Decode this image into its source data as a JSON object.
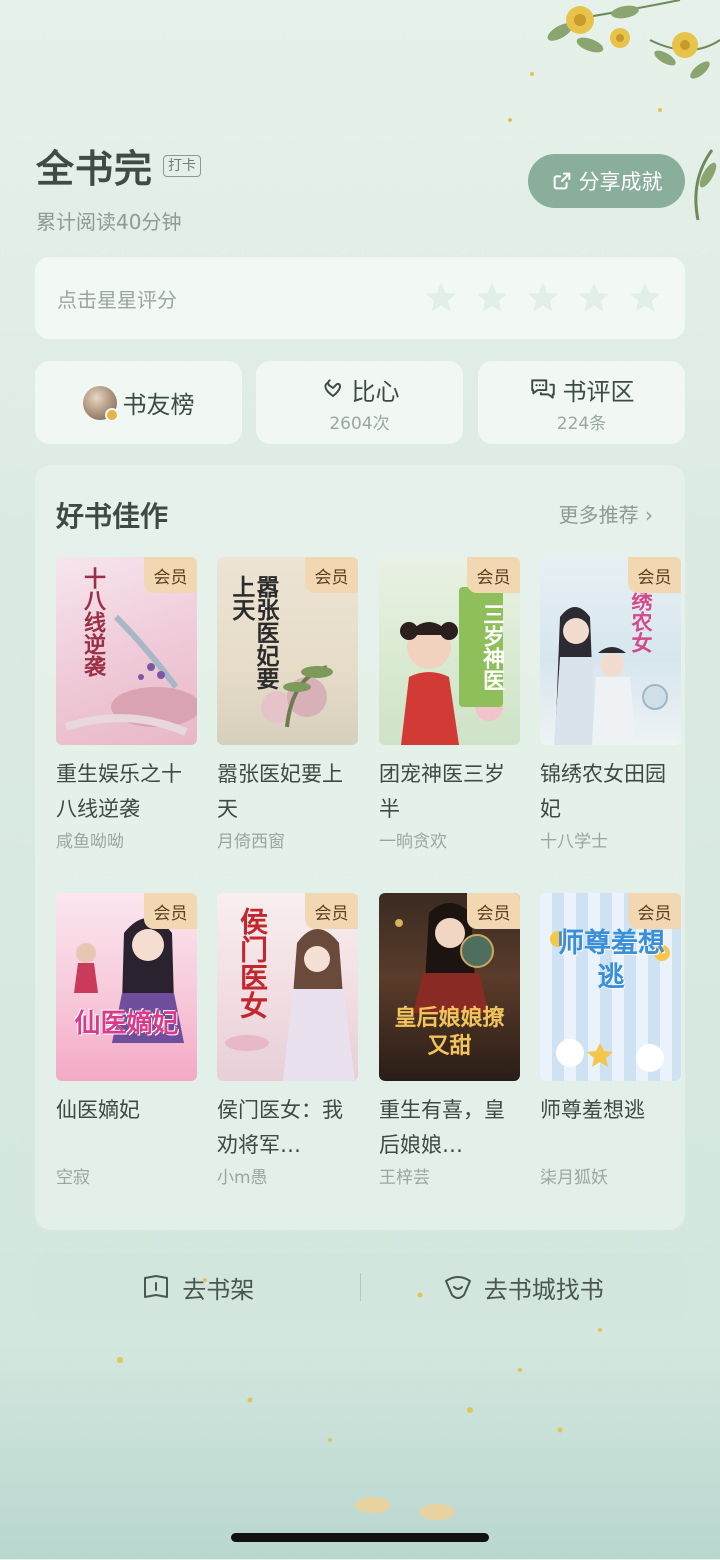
{
  "header": {
    "title": "全书完",
    "checkin_badge": "打卡",
    "subtitle": "累计阅读40分钟",
    "share_label": "分享成就"
  },
  "rating": {
    "hint": "点击星星评分",
    "stars_total": 5,
    "stars_selected": 0
  },
  "actions": {
    "friends_rank": {
      "label": "书友榜"
    },
    "heart": {
      "label": "比心",
      "count": "2604次"
    },
    "comments": {
      "label": "书评区",
      "count": "224条"
    }
  },
  "recommend": {
    "title": "好书佳作",
    "more_label": "更多推荐 ›",
    "vip_label": "会员",
    "books": [
      {
        "name": "重生娱乐之十八线逆袭",
        "author": "咸鱼呦呦",
        "cover_text": "十八线逆袭"
      },
      {
        "name": "嚣张医妃要上天",
        "author": "月倚西窗",
        "cover_text": "嚣张医妃要上天"
      },
      {
        "name": "团宠神医三岁半",
        "author": "一晌贪欢",
        "cover_text": "三岁神医"
      },
      {
        "name": "锦绣农女田园妃",
        "author": "十八学士",
        "cover_text": "锦绣农女"
      },
      {
        "name": "仙医嫡妃",
        "author": "空寂",
        "cover_text": "仙医嫡妃"
      },
      {
        "name": "侯门医女：我劝将军…",
        "author": "小m愚",
        "cover_text": "侯门医女"
      },
      {
        "name": "重生有喜，皇后娘娘…",
        "author": "王梓芸",
        "cover_text": "皇后娘娘撩又甜"
      },
      {
        "name": "师尊羞想逃",
        "author": "柒月狐妖",
        "cover_text": "师尊羞想逃"
      }
    ]
  },
  "bottom": {
    "shelf_label": "去书架",
    "store_label": "去书城找书"
  },
  "colors": {
    "accent": "#89ae9b",
    "vip_tag": "#f1d8b3",
    "background": "#dcebe2"
  }
}
